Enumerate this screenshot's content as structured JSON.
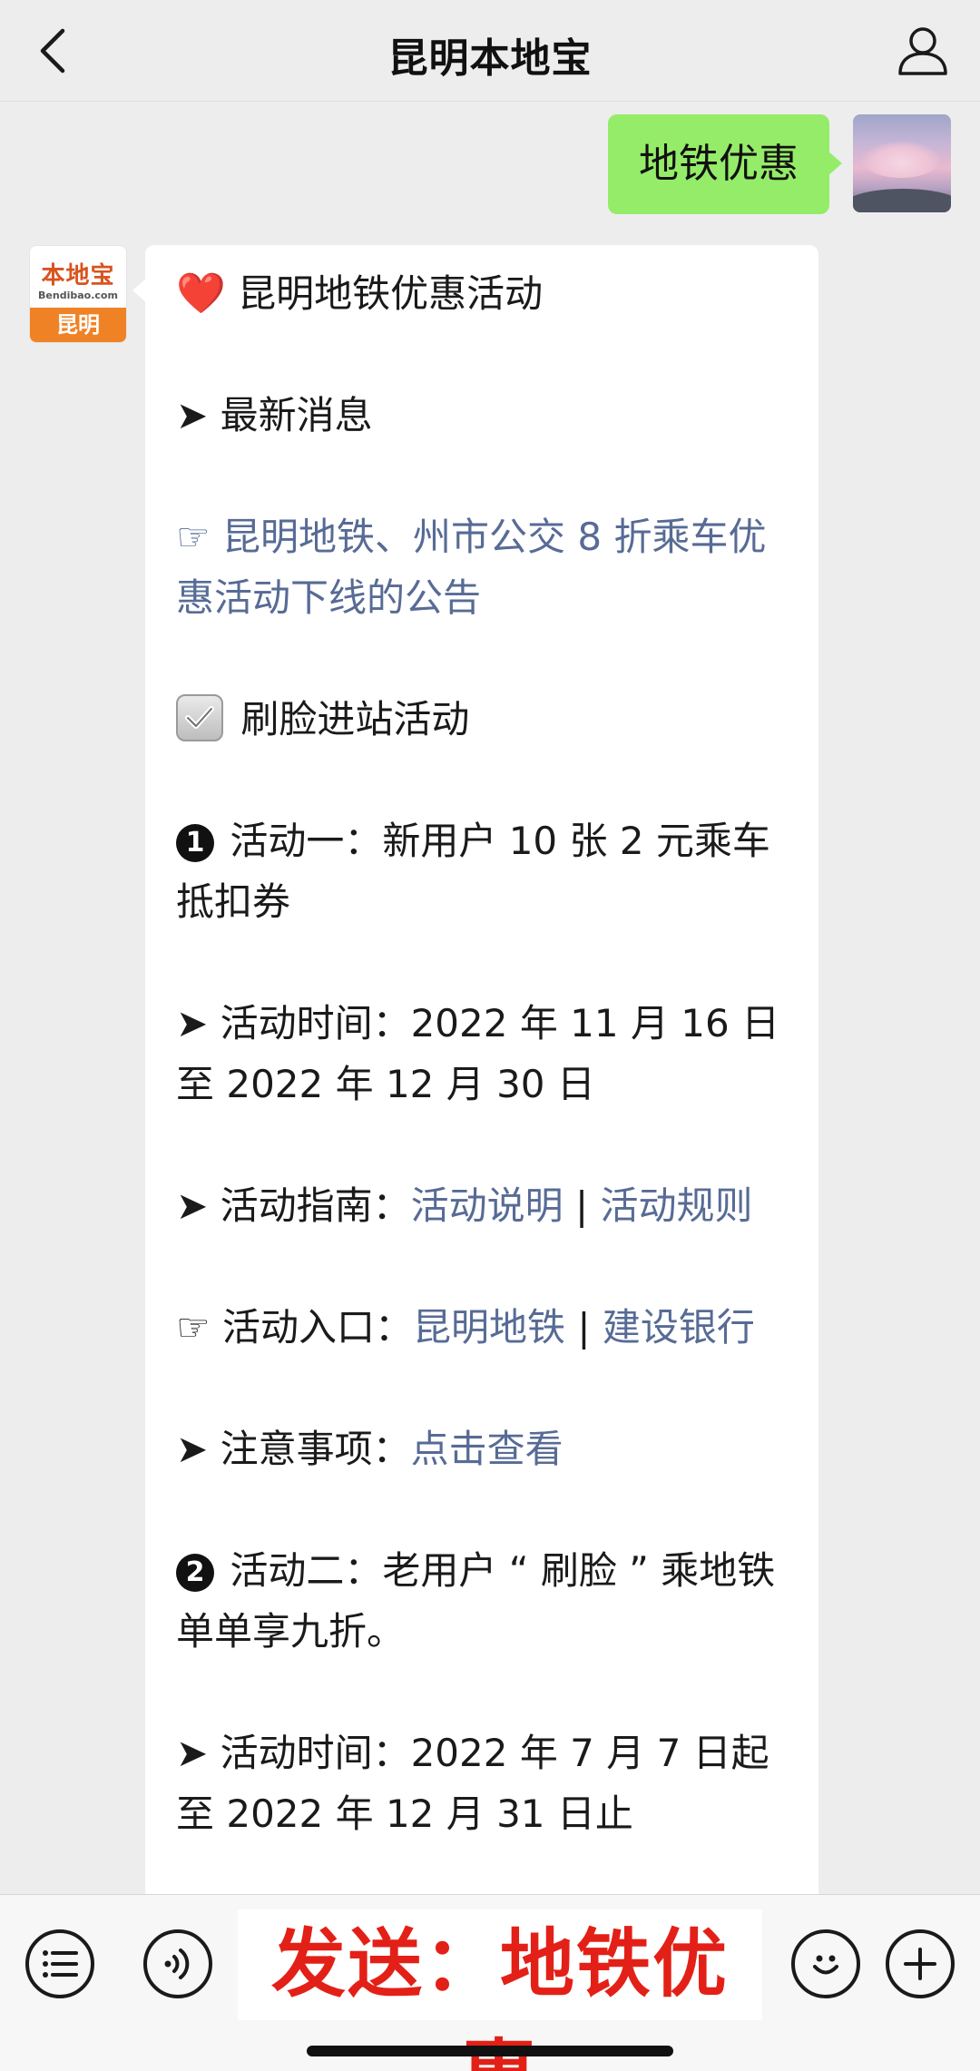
{
  "nav": {
    "title": "昆明本地宝",
    "back_icon": "chevron-left-icon",
    "profile_icon": "person-icon"
  },
  "outgoing": {
    "text": "地铁优惠"
  },
  "bot_avatar": {
    "logo_text": "本地宝",
    "logo_url": "Bendibao.com",
    "city": "昆明"
  },
  "message": {
    "title_icon": "❤️",
    "title": "昆明地铁优惠活动",
    "arrow": "➤",
    "pointer": "☞",
    "latest_label": "最新消息",
    "notice_link": "昆明地铁、州市公交 8 折乘车优惠活动下线的公告",
    "face_label": "刷脸进站活动",
    "act1_num": "1",
    "act1_text": "活动一：新用户 10 张 2 元乘车抵扣券",
    "act1_time_label": "活动时间：",
    "act1_time": "2022 年 11 月 16 日至 2022 年 12 月 30 日",
    "guide_label": "活动指南：",
    "guide_link1": "活动说明",
    "sep": " | ",
    "guide_link2": "活动规则",
    "entry_label": "活动入口：",
    "entry_link1": "昆明地铁",
    "entry_link2": "建设银行",
    "notes_label": "注意事项：",
    "notes_link": "点击查看",
    "act2_num": "2",
    "act2_text": "活动二：老用户 “ 刷脸 ” 乘地铁单单享九折。",
    "act2_time_label": "活动时间：",
    "act2_time": "2022 年 7 月 7 日起至 2022 年 12 月 31 日止"
  },
  "bottom": {
    "send_overlay": "发送：地铁优惠",
    "icons": [
      "menu-icon",
      "voice-icon",
      "emoji-icon",
      "plus-icon"
    ]
  },
  "colors": {
    "bubble_out": "#95ec69",
    "link": "#576b95",
    "overlay_text": "#e32017"
  }
}
